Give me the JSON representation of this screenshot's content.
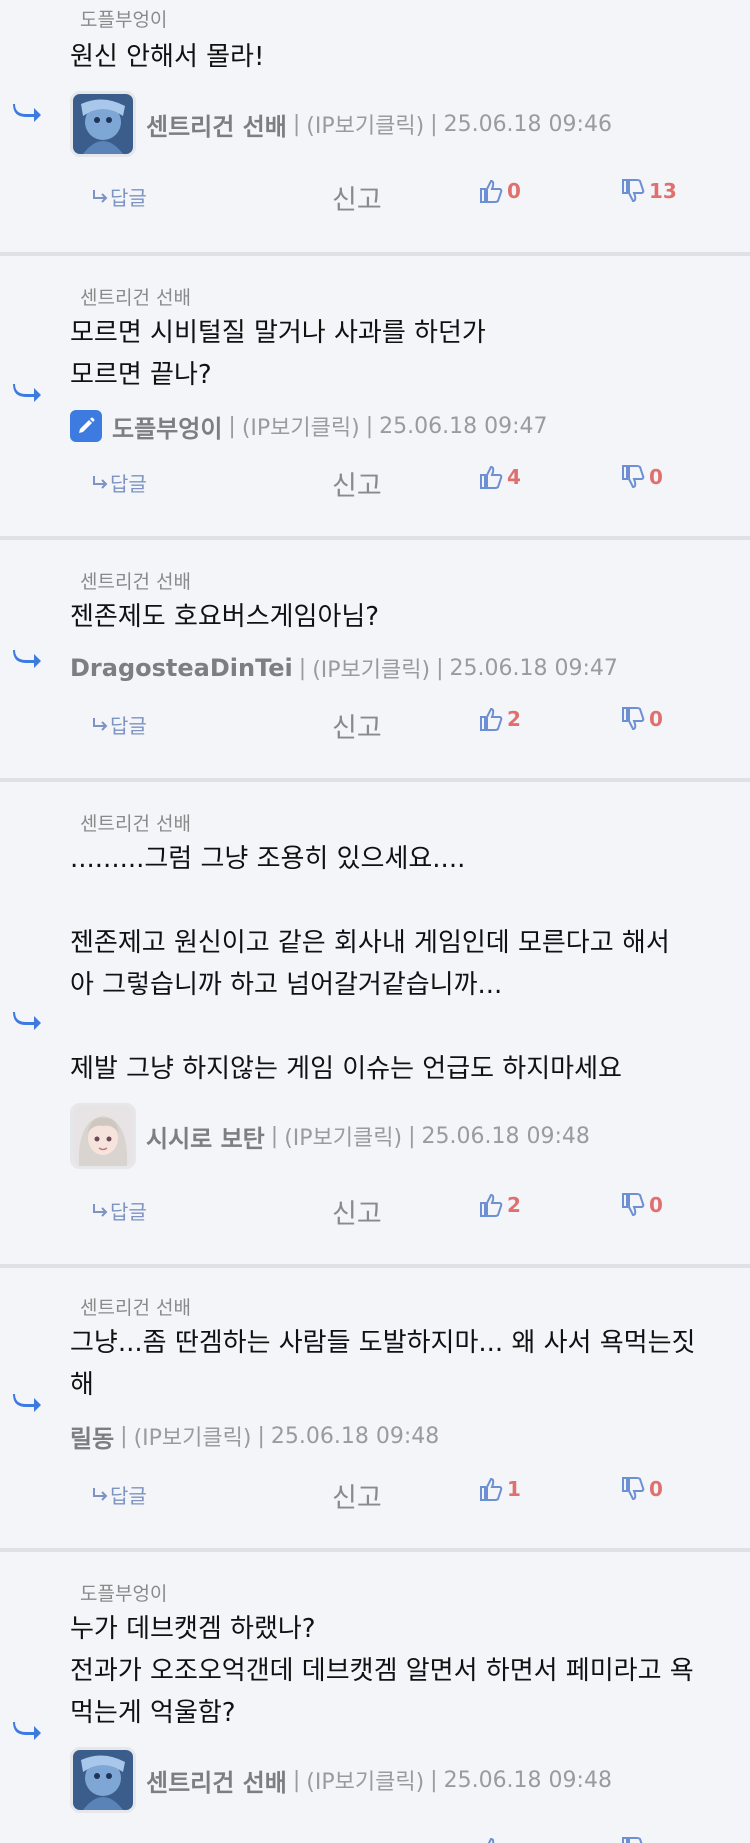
{
  "actions": {
    "reply_label": "답글",
    "report_label": "신고"
  },
  "meta": {
    "ip_label": "(IP보기클릭)",
    "separator": "|"
  },
  "colors": {
    "accent": "#3e7be0",
    "vote_count": "#e07070",
    "icon_blue": "#6d8fd4"
  },
  "comments": [
    {
      "reply_to": "도플부엉이",
      "text": "원신 안해서 몰라!",
      "author": "센트리건 선배",
      "author_icon": "avatar-blue-character",
      "date": "25.06.18 09:46",
      "likes": "0",
      "dislikes": "13"
    },
    {
      "reply_to": "센트리건 선배",
      "text": "모르면 시비털질 말거나 사과를 하던가\n모르면 끝나?",
      "author": "도플부엉이",
      "author_icon": "pencil-badge-icon",
      "date": "25.06.18 09:47",
      "likes": "4",
      "dislikes": "0"
    },
    {
      "reply_to": "센트리건 선배",
      "text": "젠존제도 호요버스게임아님?",
      "author": "DragosteaDinTei",
      "author_icon": "",
      "date": "25.06.18 09:47",
      "likes": "2",
      "dislikes": "0"
    },
    {
      "reply_to": "센트리건 선배",
      "text": ".........그럼 그냥 조용히 있으세요....\n\n젠존제고 원신이고 같은 회사내 게임인데 모른다고 해서\n아 그렇습니까 하고 넘어갈거같습니까...\n\n제발 그냥 하지않는 게임 이슈는 언급도 하지마세요",
      "author": "시시로 보탄",
      "author_icon": "avatar-anime-girl",
      "date": "25.06.18 09:48",
      "likes": "2",
      "dislikes": "0"
    },
    {
      "reply_to": "센트리건 선배",
      "text": "그냥...좀 딴겜하는 사람들 도발하지마... 왜 사서 욕먹는짓\n해",
      "author": "릴동",
      "author_icon": "",
      "date": "25.06.18 09:48",
      "likes": "1",
      "dislikes": "0"
    },
    {
      "reply_to": "도플부엉이",
      "text": "누가 데브캣겜 하랬나?\n전과가 오조오억갠데 데브캣겜 알면서 하면서 페미라고 욕\n먹는게 억울함?",
      "author": "센트리건 선배",
      "author_icon": "avatar-blue-character",
      "date": "25.06.18 09:48",
      "likes": "",
      "dislikes": ""
    }
  ]
}
